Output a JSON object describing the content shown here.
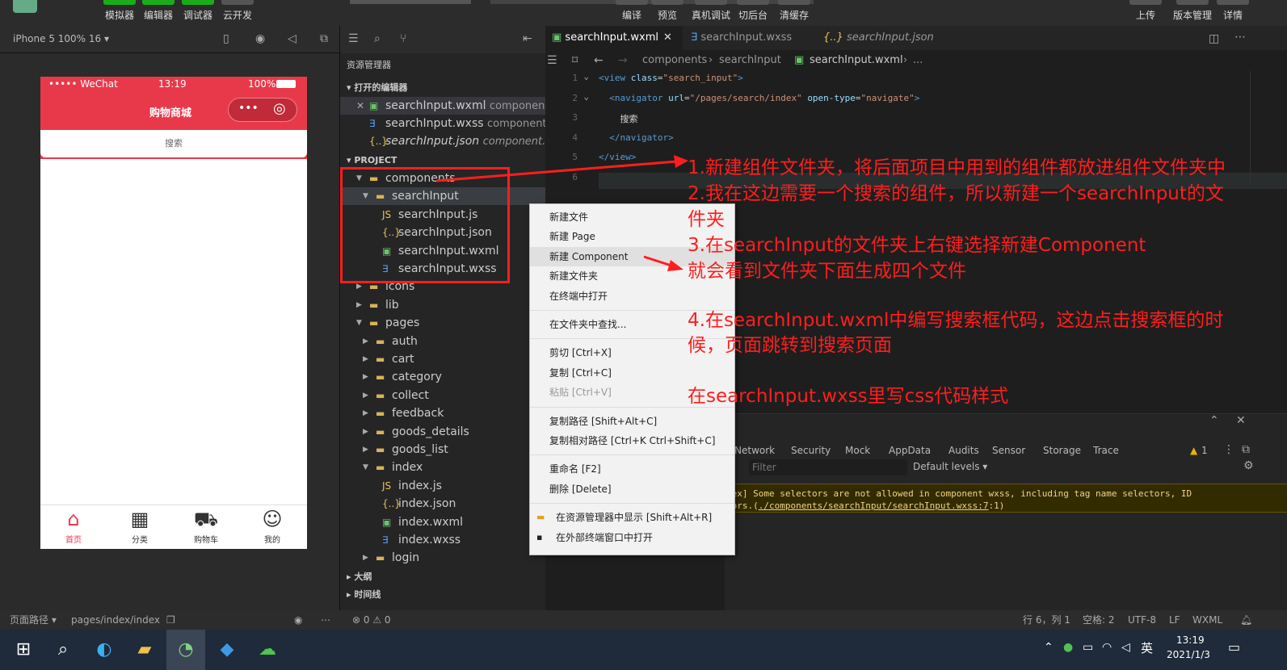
{
  "toolbar": {
    "left_buttons": [
      "模拟器",
      "编辑器",
      "调试器",
      "云开发"
    ],
    "center_buttons": [
      "编译",
      "预览",
      "真机调试",
      "切后台",
      "清缓存"
    ],
    "right_buttons": [
      "上传",
      "版本管理",
      "详情"
    ]
  },
  "device": {
    "label": "iPhone 5 100% 16 ▾"
  },
  "phone": {
    "carrier": "••••• WeChat",
    "time": "13:19",
    "battery": "100%",
    "title": "购物商城",
    "search_text": "搜索",
    "tabs": [
      {
        "label": "首页",
        "icon": "home-icon"
      },
      {
        "label": "分类",
        "icon": "grid-icon"
      },
      {
        "label": "购物车",
        "icon": "cart-icon"
      },
      {
        "label": "我的",
        "icon": "user-icon"
      }
    ],
    "accent": "#e8394a"
  },
  "explorer": {
    "title": "资源管理器",
    "open_editors_label": "打开的编辑器",
    "open_editors": [
      {
        "name": "searchInput.wxml",
        "path": "componen...",
        "type": "wxml"
      },
      {
        "name": "searchInput.wxss",
        "path": "component...",
        "type": "wxss"
      },
      {
        "name": "searchInput.json",
        "path": "component...",
        "type": "json"
      }
    ],
    "project_label": "PROJECT",
    "tree": [
      {
        "name": "components",
        "depth": 0,
        "kind": "folder",
        "open": true
      },
      {
        "name": "searchInput",
        "depth": 1,
        "kind": "folder",
        "open": true
      },
      {
        "name": "searchInput.js",
        "depth": 2,
        "kind": "js"
      },
      {
        "name": "searchInput.json",
        "depth": 2,
        "kind": "json"
      },
      {
        "name": "searchInput.wxml",
        "depth": 2,
        "kind": "wxml"
      },
      {
        "name": "searchInput.wxss",
        "depth": 2,
        "kind": "wxss"
      },
      {
        "name": "icons",
        "depth": 0,
        "kind": "folder",
        "open": false
      },
      {
        "name": "lib",
        "depth": 0,
        "kind": "folder",
        "open": false
      },
      {
        "name": "pages",
        "depth": 0,
        "kind": "folder",
        "open": true
      },
      {
        "name": "auth",
        "depth": 1,
        "kind": "folder",
        "open": false
      },
      {
        "name": "cart",
        "depth": 1,
        "kind": "folder",
        "open": false
      },
      {
        "name": "category",
        "depth": 1,
        "kind": "folder",
        "open": false
      },
      {
        "name": "collect",
        "depth": 1,
        "kind": "folder",
        "open": false
      },
      {
        "name": "feedback",
        "depth": 1,
        "kind": "folder",
        "open": false
      },
      {
        "name": "goods_details",
        "depth": 1,
        "kind": "folder",
        "open": false
      },
      {
        "name": "goods_list",
        "depth": 1,
        "kind": "folder",
        "open": false
      },
      {
        "name": "index",
        "depth": 1,
        "kind": "folder",
        "open": true
      },
      {
        "name": "index.js",
        "depth": 2,
        "kind": "js"
      },
      {
        "name": "index.json",
        "depth": 2,
        "kind": "json"
      },
      {
        "name": "index.wxml",
        "depth": 2,
        "kind": "wxml"
      },
      {
        "name": "index.wxss",
        "depth": 2,
        "kind": "wxss"
      },
      {
        "name": "login",
        "depth": 1,
        "kind": "folder",
        "open": false
      }
    ],
    "outline_label": "大纲",
    "timeline_label": "时间线"
  },
  "editor": {
    "tabs": [
      {
        "label": "searchInput.wxml",
        "type": "wxml",
        "active": true
      },
      {
        "label": "searchInput.wxss",
        "type": "wxss",
        "active": false
      },
      {
        "label": "searchInput.json",
        "type": "json",
        "active": false
      }
    ],
    "breadcrumb": [
      "components",
      "searchInput",
      "searchInput.wxml",
      "..."
    ],
    "lines": [
      {
        "n": "1",
        "html": "<span class=\"tag\">&lt;view</span> <span class=\"attr\">class</span>=<span class=\"str\">\"search_input\"</span><span class=\"tag\">&gt;</span>"
      },
      {
        "n": "2",
        "html": "  <span class=\"tag\">&lt;navigator</span> <span class=\"attr\">url</span>=<span class=\"str\">\"/pages/search/index\"</span> <span class=\"attr\">open-type</span>=<span class=\"str\">\"navigate\"</span><span class=\"tag\">&gt;</span>"
      },
      {
        "n": "3",
        "html": "    <span class=\"txt\">搜索</span>"
      },
      {
        "n": "4",
        "html": "  <span class=\"tag\">&lt;/navigator&gt;</span>"
      },
      {
        "n": "5",
        "html": "<span class=\"tag\">&lt;/view&gt;</span>"
      },
      {
        "n": "6",
        "html": ""
      }
    ]
  },
  "context_menu": {
    "groups": [
      [
        "新建文件",
        "新建 Page",
        "新建 Component",
        "新建文件夹",
        "在终端中打开"
      ],
      [
        "在文件夹中查找..."
      ],
      [
        "剪切  [Ctrl+X]",
        "复制  [Ctrl+C]",
        "粘贴  [Ctrl+V]"
      ],
      [
        "复制路径  [Shift+Alt+C]",
        "复制相对路径  [Ctrl+K Ctrl+Shift+C]"
      ],
      [
        "重命名  [F2]",
        "删除  [Delete]"
      ],
      [
        "在资源管理器中显示  [Shift+Alt+R]",
        "在外部终端窗口中打开"
      ]
    ]
  },
  "console": {
    "tabs": [
      "Network",
      "Security",
      "Mock",
      "AppData",
      "Audits",
      "Sensor",
      "Storage",
      "Trace"
    ],
    "warn_count": "1",
    "filter_placeholder": "Filter",
    "levels": "Default levels ▾",
    "warn_line1": "dex] Some selectors are not allowed in component wxss, including tag name selectors, ID",
    "warn_line2_prefix": "tors.(",
    "warn_link": "./components/searchInput/searchInput.wxss:7",
    "warn_line2_suffix": ":1)"
  },
  "statusbar": {
    "left": "页面路径 ▾",
    "path": "pages/index/index",
    "problems": "⊗ 0 ⚠ 0",
    "cursor": "行 6，列 1",
    "spaces": "空格: 2",
    "encoding": "UTF-8",
    "eol": "LF",
    "lang": "WXML"
  },
  "taskbar": {
    "time": "13:19",
    "date": "2021/1/3",
    "ime": "英"
  },
  "annotations": [
    "1.新建组件文件夹，将后面项目中用到的组件都放进组件文件夹中",
    "2.我在这边需要一个搜索的组件，所以新建一个searchInput的文",
    "件夹",
    "3.在searchInput的文件夹上右键选择新建Component",
    "就会看到文件夹下面生成四个文件",
    "4.在searchInput.wxml中编写搜索框代码，这边点击搜索框的时",
    "候，页面跳转到搜索页面",
    "在searchInput.wxss里写css代码样式"
  ]
}
